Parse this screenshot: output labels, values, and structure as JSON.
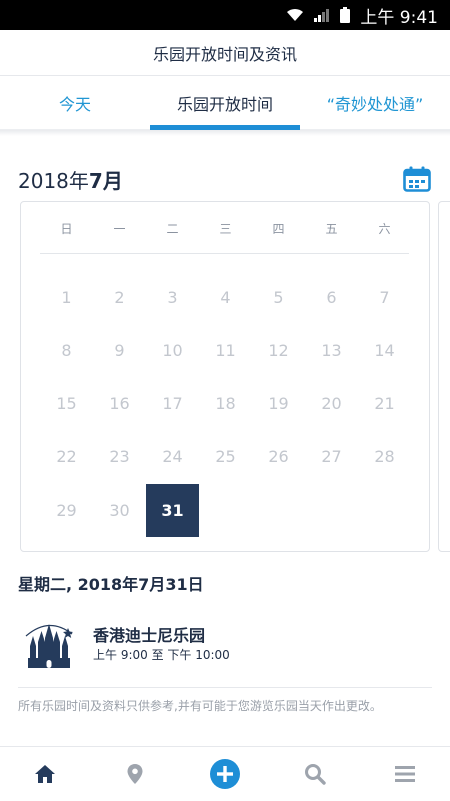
{
  "status_bar": {
    "time": "上午 9:41"
  },
  "header": {
    "title": "乐园开放时间及资讯"
  },
  "tabs": [
    {
      "label": "今天"
    },
    {
      "label": "乐园开放时间"
    },
    {
      "label": "“奇妙处处通”"
    }
  ],
  "calendar": {
    "year_part": "2018年",
    "month_part": "7月",
    "weekdays": [
      "日",
      "一",
      "二",
      "三",
      "四",
      "五",
      "六"
    ],
    "days": [
      "1",
      "2",
      "3",
      "4",
      "5",
      "6",
      "7",
      "8",
      "9",
      "10",
      "11",
      "12",
      "13",
      "14",
      "15",
      "16",
      "17",
      "18",
      "19",
      "20",
      "21",
      "22",
      "23",
      "24",
      "25",
      "26",
      "27",
      "28",
      "29",
      "30",
      "31"
    ],
    "selected_day": "31"
  },
  "selected_date": {
    "heading": "星期二, 2018年7月31日"
  },
  "park": {
    "name": "香港迪士尼乐园",
    "hours": "上午 9:00 至 下午 10:00"
  },
  "disclaimer": "所有乐园时间及资料只供参考,并有可能于您游览乐园当天作出更改。",
  "bottom_nav": {
    "icons": [
      "home-icon",
      "location-pin-icon",
      "plus-icon",
      "search-icon",
      "menu-icon"
    ],
    "colors": {
      "active": "#253b5c",
      "inactive": "#9ea4ad",
      "accent": "#1e8ed6"
    }
  }
}
